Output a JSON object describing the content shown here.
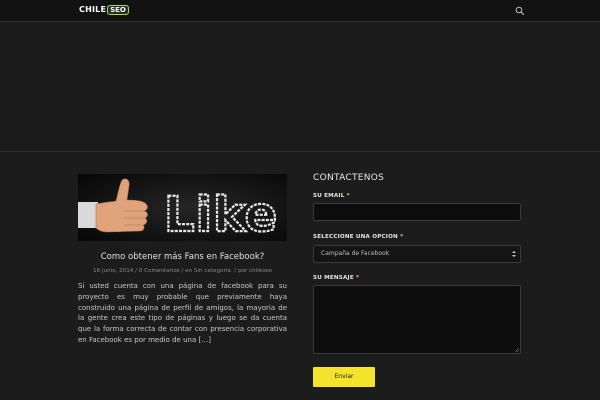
{
  "header": {
    "logo_main": "CHILE",
    "logo_badge": "SEO",
    "search_icon": "search-icon"
  },
  "post": {
    "image_text": "Like",
    "title": "Como obtener más Fans en Facebook?",
    "date": "16 junio, 2014",
    "comments": "0 Comentarios",
    "category": "en Sin categoría",
    "author": "por chileseo",
    "excerpt": "Si usted cuenta con una página de facebook para su proyecto es muy probable que  previamente haya construido una página de perfil de amigos, la mayoria de la gente crea este tipo de páginas y luego se da cuenta que la forma correcta de contar con presencia corporativa en Facebook es por medio de una […]"
  },
  "contact": {
    "heading": "CONTACTENOS",
    "email_label": "SU EMAIL",
    "option_label": "SELECCIONE UNA OPCION",
    "option_selected": "Campaña de Facebook",
    "message_label": "SU MENSAJE",
    "required_mark": "*",
    "submit_label": "Enviar"
  },
  "colors": {
    "background": "#1c1c1c",
    "accent_yellow": "#f3e32a",
    "logo_green": "#9be52a"
  }
}
